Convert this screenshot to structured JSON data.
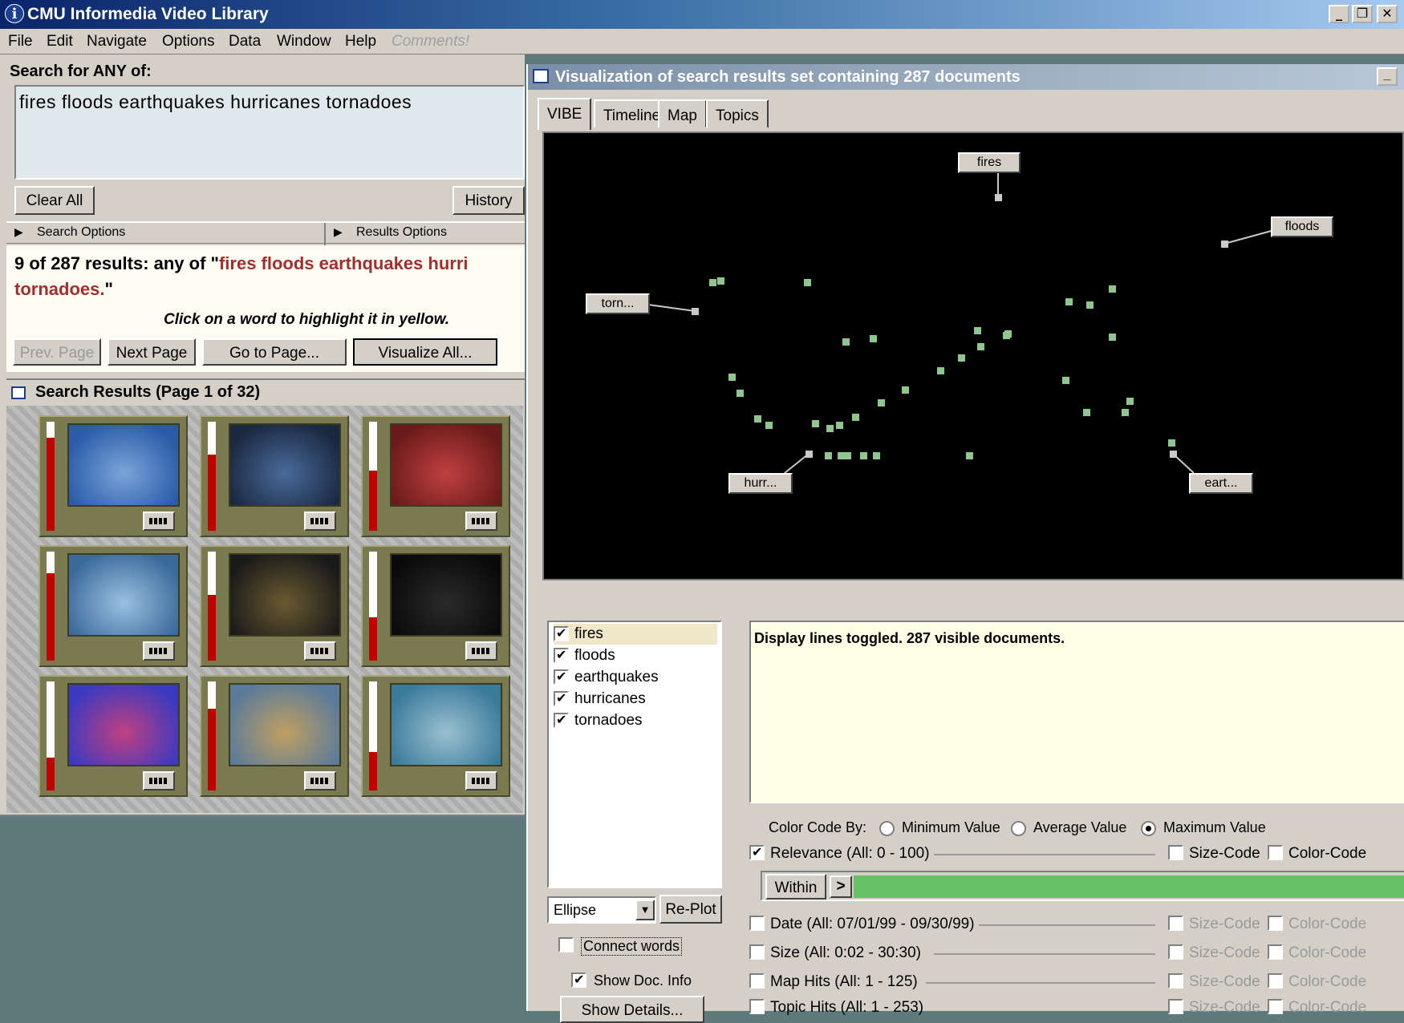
{
  "window": {
    "title": "CMU Informedia Video Library",
    "icon": "info-icon"
  },
  "menu": [
    "File",
    "Edit",
    "Navigate",
    "Options",
    "Data",
    "Window",
    "Help",
    "Comments!"
  ],
  "search": {
    "heading": "Search for ANY of:",
    "query": "fires floods earthquakes hurricanes tornadoes",
    "clear_label": "Clear All",
    "history_label": "History",
    "search_options": "Search Options",
    "results_options": "Results Options"
  },
  "results": {
    "summary_prefix": "9 of 287 results: any of \"",
    "summary_terms": "fires floods earthquakes hurri",
    "summary_terms2": "tornadoes.",
    "summary_suffix": "\"",
    "hint": "Click on a word to highlight it in yellow.",
    "prev_label": "Prev. Page",
    "next_label": "Next Page",
    "goto_label": "Go to Page...",
    "visualize_label": "Visualize All...",
    "grid_title": "Search Results (Page 1 of 32)",
    "relevance": [
      0.85,
      0.7,
      0.55,
      0.8,
      0.6,
      0.4,
      0.3,
      0.75,
      0.35
    ]
  },
  "viz": {
    "title": "Visualization of search results set containing 287 documents",
    "tabs": [
      "VIBE",
      "Timeline",
      "Map",
      "Topics"
    ],
    "nodes": {
      "fires": "fires",
      "floods": "floods",
      "torn": "torn...",
      "hurr": "hurr...",
      "eart": "eart..."
    },
    "terms": [
      "fires",
      "floods",
      "earthquakes",
      "hurricanes",
      "tornadoes"
    ],
    "status": "Display lines toggled.   287 visible documents.",
    "shape": "Ellipse",
    "replot_label": "Re-Plot",
    "connect_label": "Connect words",
    "showdoc_label": "Show Doc. Info",
    "showdetails_label": "Show Details...",
    "colorcode_label": "Color Code By:",
    "radio_min": "Minimum Value",
    "radio_avg": "Average Value",
    "radio_max": "Maximum Value",
    "relevance_label": "Relevance  (All: 0 - 100)",
    "sizecode": "Size-Code",
    "colorcode": "Color-Code",
    "within_label": "Within",
    "date_label": "Date  (All: 07/01/99 - 09/30/99)",
    "size_label": "Size  (All: 0:02 - 30:30)",
    "maphits_label": "Map Hits (All: 1 - 125)",
    "topichits_label": "Topic Hits (All: 1 - 253)",
    "accent_green": "#66c266",
    "dot_color": "#8fc68f"
  }
}
